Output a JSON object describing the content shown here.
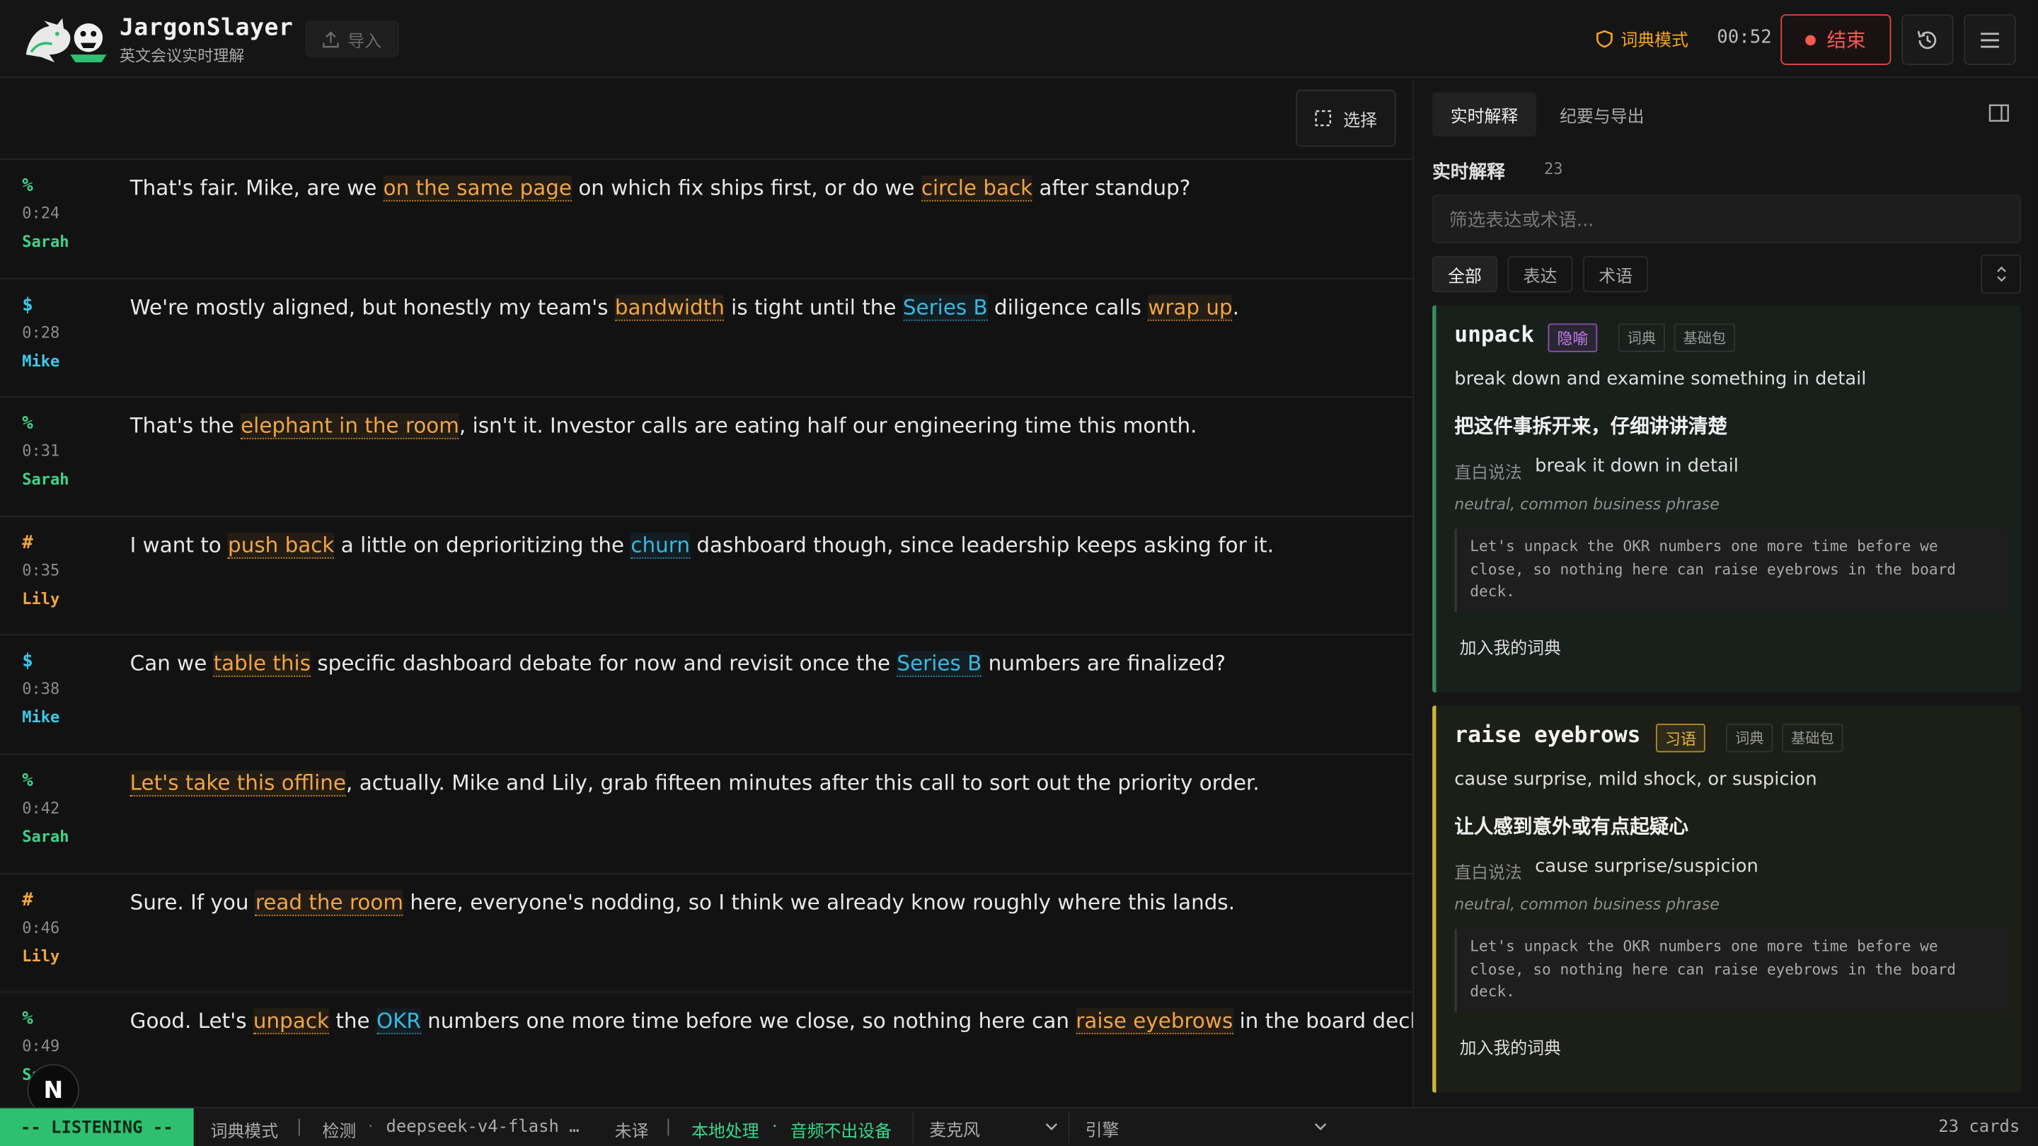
{
  "app": {
    "name": "JargonSlayer",
    "subtitle": "英文会议实时理解",
    "import_label": "导入"
  },
  "header": {
    "mode_label": "词典模式",
    "timer": "00:52",
    "end_label": "结束"
  },
  "toolbar": {
    "select_label": "选择"
  },
  "transcript": [
    {
      "sym": "%",
      "time": "0:24",
      "speaker": "Sarah",
      "color": "#3dd68c",
      "parts": [
        {
          "t": "That's fair. Mike, are we "
        },
        {
          "t": "on the same page",
          "k": "e"
        },
        {
          "t": " on which fix ships first, or do we "
        },
        {
          "t": "circle back",
          "k": "e"
        },
        {
          "t": " after standup?"
        }
      ]
    },
    {
      "sym": "$",
      "time": "0:28",
      "speaker": "Mike",
      "color": "#3ec9ec",
      "parts": [
        {
          "t": "We're mostly aligned, but honestly my team's "
        },
        {
          "t": "bandwidth",
          "k": "e"
        },
        {
          "t": " is tight until the "
        },
        {
          "t": "Series B",
          "k": "t"
        },
        {
          "t": " diligence calls "
        },
        {
          "t": "wrap up",
          "k": "e"
        },
        {
          "t": "."
        }
      ]
    },
    {
      "sym": "%",
      "time": "0:31",
      "speaker": "Sarah",
      "color": "#3dd68c",
      "parts": [
        {
          "t": "That's the "
        },
        {
          "t": "elephant in the room",
          "k": "e"
        },
        {
          "t": ", isn't it. Investor calls are eating half our engineering time this month."
        }
      ]
    },
    {
      "sym": "#",
      "time": "0:35",
      "speaker": "Lily",
      "color": "#f0a544",
      "parts": [
        {
          "t": "I want to "
        },
        {
          "t": "push back",
          "k": "e"
        },
        {
          "t": " a little on deprioritizing the "
        },
        {
          "t": "churn",
          "k": "t"
        },
        {
          "t": " dashboard though, since leadership keeps asking for it."
        }
      ]
    },
    {
      "sym": "$",
      "time": "0:38",
      "speaker": "Mike",
      "color": "#3ec9ec",
      "parts": [
        {
          "t": "Can we "
        },
        {
          "t": "table this",
          "k": "e"
        },
        {
          "t": " specific dashboard debate for now and revisit once the "
        },
        {
          "t": "Series B",
          "k": "t"
        },
        {
          "t": " numbers are finalized?"
        }
      ]
    },
    {
      "sym": "%",
      "time": "0:42",
      "speaker": "Sarah",
      "color": "#3dd68c",
      "parts": [
        {
          "t": "Let's take this offline",
          "k": "e"
        },
        {
          "t": ", actually. Mike and Lily, grab fifteen minutes after this call to sort out the priority order."
        }
      ]
    },
    {
      "sym": "#",
      "time": "0:46",
      "speaker": "Lily",
      "color": "#f0a544",
      "parts": [
        {
          "t": "Sure. If you "
        },
        {
          "t": "read the room",
          "k": "e"
        },
        {
          "t": " here, everyone's nodding, so I think we already know roughly where this lands."
        }
      ]
    },
    {
      "sym": "%",
      "time": "0:49",
      "speaker": "Sarah",
      "color": "#3dd68c",
      "parts": [
        {
          "t": "Good. Let's "
        },
        {
          "t": "unpack",
          "k": "e"
        },
        {
          "t": " the "
        },
        {
          "t": "OKR",
          "k": "t"
        },
        {
          "t": " numbers one more time before we close, so nothing here can "
        },
        {
          "t": "raise eyebrows",
          "k": "e"
        },
        {
          "t": " in the board deck."
        }
      ]
    }
  ],
  "floating_badge": "N",
  "panel": {
    "tabs": [
      "实时解释",
      "纪要与导出"
    ],
    "title": "实时解释",
    "count": "23",
    "filter_placeholder": "筛选表达或术语...",
    "chips": [
      "全部",
      "表达",
      "术语"
    ],
    "cards": [
      {
        "term": "unpack",
        "kind": "隐喻",
        "tags": [
          "词典",
          "基础包"
        ],
        "definition": "break down and examine something in detail",
        "zh": "把这件事拆开来，仔细讲讲清楚",
        "plain_label": "直白说法",
        "plain": "break it down in detail",
        "register": "neutral, common business phrase",
        "example": "Let's unpack the OKR numbers one more time before we close, so nothing here can raise eyebrows in the board deck.",
        "add_label": "加入我的词典"
      },
      {
        "term": "raise eyebrows",
        "kind": "习语",
        "tags": [
          "词典",
          "基础包"
        ],
        "definition": "cause surprise, mild shock, or suspicion",
        "zh": "让人感到意外或有点起疑心",
        "plain_label": "直白说法",
        "plain": "cause surprise/suspicion",
        "register": "neutral, common business phrase",
        "example": "Let's unpack the OKR numbers one more time before we close, so nothing here can raise eyebrows in the board deck.",
        "add_label": "加入我的词典"
      }
    ]
  },
  "statusbar": {
    "listening": "-- LISTENING --",
    "mode": "词典模式",
    "detect_label": "检测",
    "model": "deepseek-v4-flash …",
    "translate": "未译",
    "local": "本地处理",
    "audio": "音频不出设备",
    "mic": "麦克风",
    "engine": "引擎",
    "cards": "23 cards"
  },
  "colors": {
    "accent_green": "#2fbf70",
    "end_red": "#f25a50",
    "expression": "#f0a544",
    "term": "#39b8e0"
  }
}
